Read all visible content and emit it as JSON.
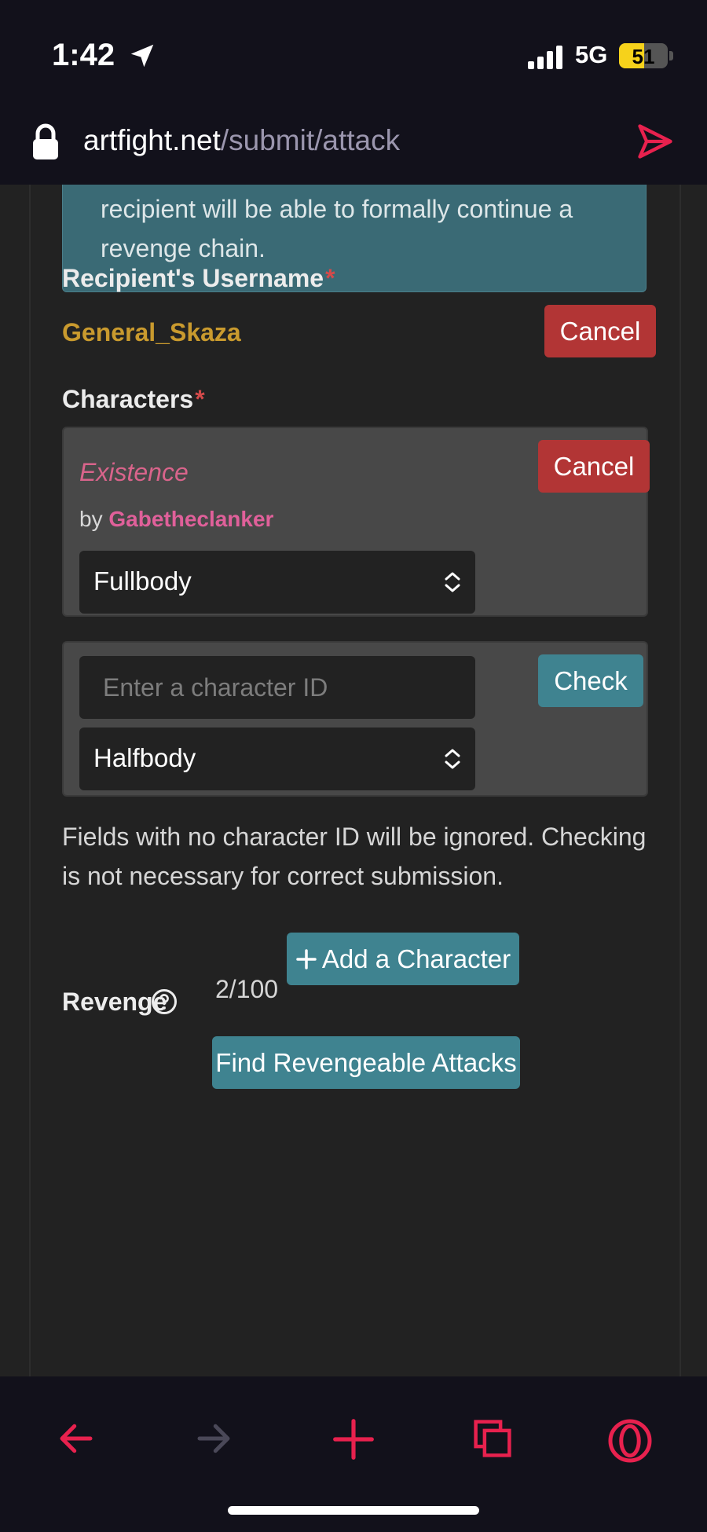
{
  "status_bar": {
    "time": "1:42",
    "network": "5G",
    "battery": "51",
    "battery_level": 0.51
  },
  "url_bar": {
    "host": "artfight.net",
    "path": "/submit/attack"
  },
  "info": {
    "text": "recipient will be able to formally continue a revenge chain."
  },
  "recipient": {
    "label": "Recipient's Username",
    "required_mark": "*",
    "username": "General_Skaza",
    "cancel_label": "Cancel"
  },
  "characters": {
    "label": "Characters",
    "required_mark": "*",
    "selected": {
      "name": "Existence",
      "by_prefix": "by",
      "owner": "Gabetheclanker",
      "cancel_label": "Cancel",
      "type": "Fullbody"
    },
    "entry": {
      "placeholder": "Enter a character ID",
      "value": "",
      "check_label": "Check",
      "type": "Halfbody"
    },
    "note": "Fields with no character ID will be ignored. Checking is not necessary for correct submission.",
    "count": "2/100",
    "add_label": "Add a Character"
  },
  "revenge": {
    "label": "Revenge",
    "find_label": "Find Revengeable Attacks"
  },
  "colors": {
    "accent_red": "#e8214e",
    "teal": "#3f8390",
    "cancel_red": "#b23535",
    "username_gold": "#c99a2e",
    "char_pink": "#d9648b"
  },
  "icons": [
    "location-arrow-icon",
    "signal-icon",
    "lock-icon",
    "send-icon",
    "chevron-updown-icon",
    "plus-icon",
    "help-icon",
    "back-arrow-icon",
    "forward-arrow-icon",
    "new-tab-plus-icon",
    "tabs-icon",
    "opera-icon"
  ]
}
